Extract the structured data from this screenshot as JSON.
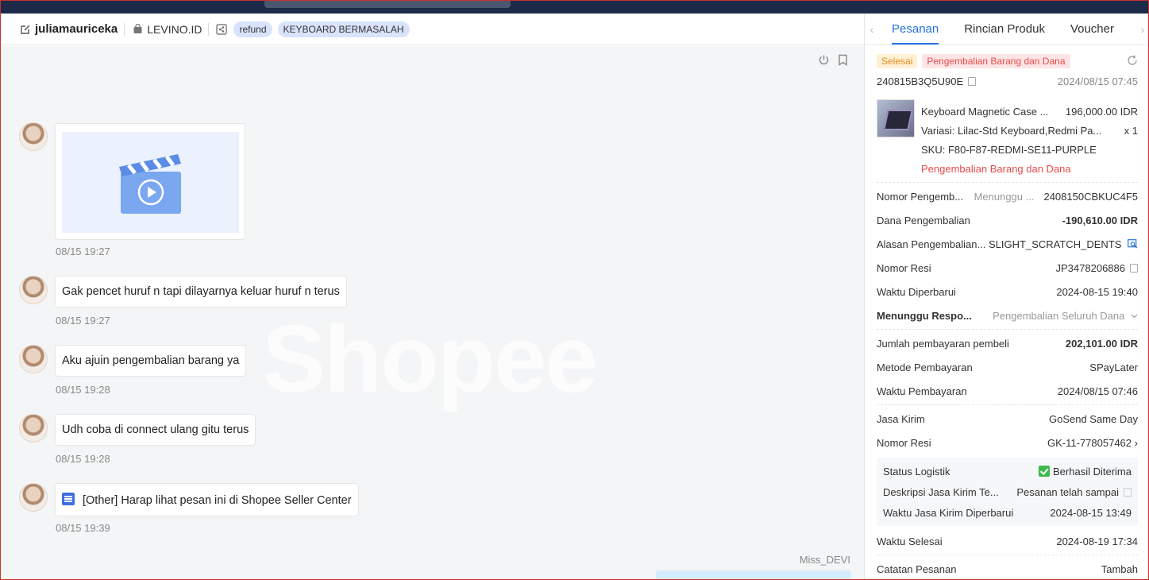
{
  "header": {
    "username": "juliamauriceka",
    "shop": "LEVINO.ID",
    "tags": [
      "refund",
      "KEYBOARD BERMASALAH"
    ]
  },
  "chat": {
    "watermark": "Shopee",
    "messages": [
      {
        "type": "video",
        "time": "08/15 19:27"
      },
      {
        "type": "text",
        "text": "Gak pencet huruf n tapi dilayarnya keluar huruf n terus",
        "time": "08/15 19:27"
      },
      {
        "type": "text",
        "text": "Aku ajuin pengembalian barang ya",
        "time": "08/15 19:28"
      },
      {
        "type": "text",
        "text": "Udh coba di connect ulang gitu terus",
        "time": "08/15 19:28"
      },
      {
        "type": "other",
        "text": "[Other] Harap lihat pesan ini di Shopee Seller Center",
        "time": "08/15 19:39"
      }
    ],
    "sender_name": "Miss_DEVI"
  },
  "panel": {
    "tabs": [
      "Pesanan",
      "Rincian Produk",
      "Voucher"
    ],
    "active_tab": "Pesanan",
    "status_badge": "Selesai",
    "return_badge": "Pengembalian Barang dan Dana",
    "order_id": "240815B3Q5U90E",
    "order_time": "2024/08/15 07:45",
    "product": {
      "name": "Keyboard Magnetic Case ...",
      "price": "196,000.00 IDR",
      "variant": "Variasi: Lilac-Std Keyboard,Redmi Pa...",
      "qty": "x 1",
      "sku": "SKU: F80-F87-REDMI-SE11-PURPLE",
      "status": "Pengembalian Barang dan Dana"
    },
    "rows": [
      {
        "label": "Nomor Pengemb...",
        "mid": "Menunggu ...",
        "value": "2408150CBKUC4F5"
      },
      {
        "label": "Dana Pengembalian",
        "value": "-190,610.00 IDR"
      },
      {
        "label": "Alasan Pengembalian...",
        "value": "SLIGHT_SCRATCH_DENTS"
      },
      {
        "label": "Nomor Resi",
        "value": "JP3478206886"
      },
      {
        "label": "Waktu Diperbarui",
        "value": "2024-08-15 19:40"
      },
      {
        "label": "Menunggu Respo...",
        "value": "Pengembalian Seluruh Dana"
      },
      {
        "label": "Jumlah pembayaran pembeli",
        "value": "202,101.00 IDR"
      },
      {
        "label": "Metode Pembayaran",
        "value": "SPayLater"
      },
      {
        "label": "Waktu Pembayaran",
        "value": "2024/08/15 07:46"
      },
      {
        "label": "Jasa Kirim",
        "value": "GoSend Same Day"
      },
      {
        "label": "Nomor Resi",
        "value": "GK-11-778057462"
      }
    ],
    "logistics": [
      {
        "label": "Status Logistik",
        "value": "Berhasil Diterima"
      },
      {
        "label": "Deskripsi Jasa Kirim Te...",
        "value": "Pesanan telah sampai"
      },
      {
        "label": "Waktu Jasa Kirim Diperbarui",
        "value": "2024-08-15 13:49"
      }
    ],
    "finish_label": "Waktu Selesai",
    "finish_value": "2024-08-19 17:34",
    "note_label": "Catatan Pesanan",
    "note_action": "Tambah"
  }
}
